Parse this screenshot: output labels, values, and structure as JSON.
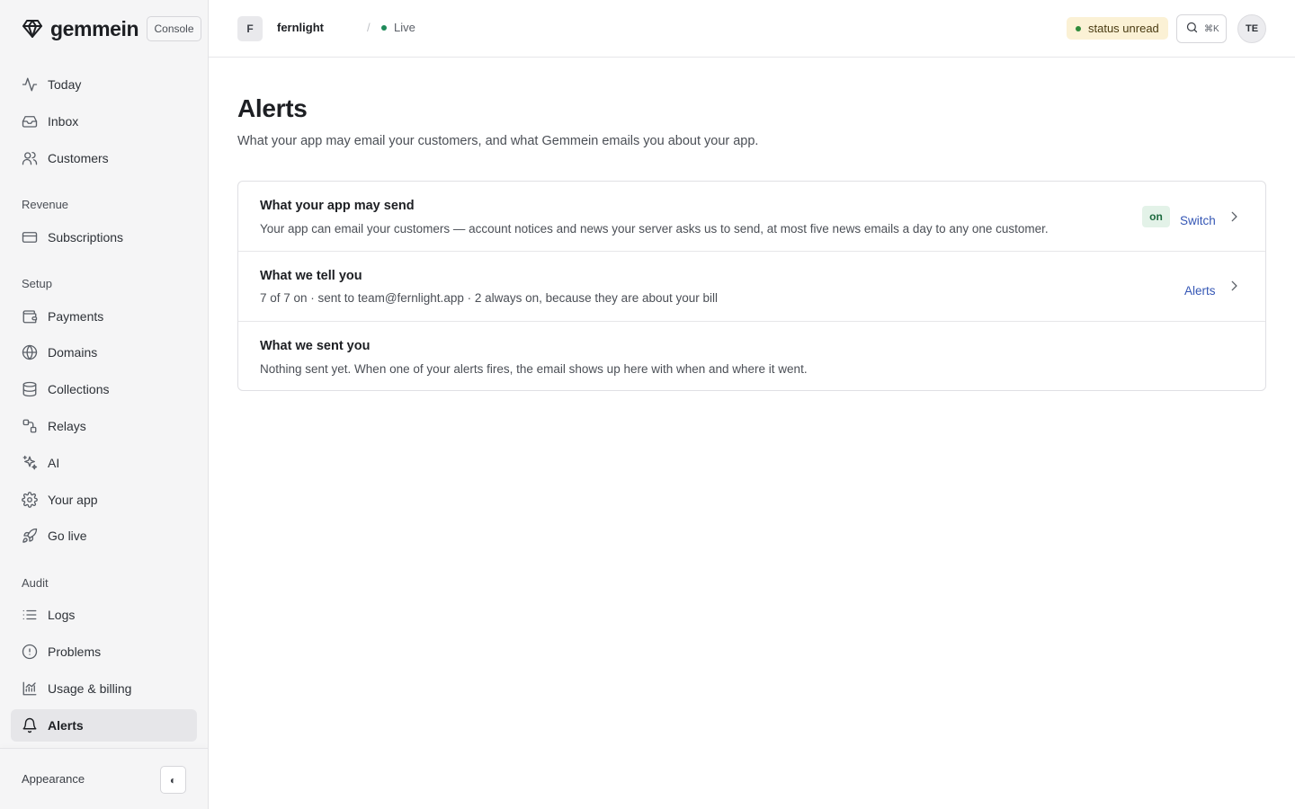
{
  "brand": {
    "name": "gemmein",
    "console_label": "Console",
    "logo_icon": "diamond-icon"
  },
  "sidebar": {
    "items_top": [
      {
        "label": "Today",
        "icon": "activity-icon"
      },
      {
        "label": "Inbox",
        "icon": "inbox-icon"
      },
      {
        "label": "Customers",
        "icon": "users-icon"
      }
    ],
    "sections": {
      "revenue": "Revenue",
      "setup": "Setup",
      "audit": "Audit"
    },
    "revenue_items": [
      {
        "label": "Subscriptions",
        "icon": "credit-card-icon"
      }
    ],
    "setup_items": [
      {
        "label": "Payments",
        "icon": "wallet-icon"
      },
      {
        "label": "Domains",
        "icon": "globe-icon"
      },
      {
        "label": "Collections",
        "icon": "database-icon"
      },
      {
        "label": "Relays",
        "icon": "route-icon"
      },
      {
        "label": "AI",
        "icon": "sparkles-icon"
      },
      {
        "label": "Your app",
        "icon": "gear-icon"
      },
      {
        "label": "Go live",
        "icon": "rocket-icon"
      }
    ],
    "audit_items": [
      {
        "label": "Logs",
        "icon": "list-icon"
      },
      {
        "label": "Problems",
        "icon": "alert-circle-icon"
      },
      {
        "label": "Usage & billing",
        "icon": "chart-icon"
      },
      {
        "label": "Alerts",
        "icon": "bell-icon",
        "active": true
      }
    ],
    "appearance_label": "Appearance",
    "appearance_toggle": "◐"
  },
  "topbar": {
    "project_initial": "F",
    "project_name": "fernlight",
    "separator": "/",
    "environment": "Live",
    "status": "status unread",
    "search_shortcut": "⌘K",
    "user_initials": "TE"
  },
  "page": {
    "title": "Alerts",
    "subtitle": "What your app may email your customers, and what Gemmein emails you about your app."
  },
  "rows": [
    {
      "title": "What your app may send",
      "desc": "Your app can email your customers — account notices and news your server asks us to send, at most five news emails a day to any one customer.",
      "badge": "on",
      "link": "Switch"
    },
    {
      "title": "What we tell you",
      "desc": "7 of 7 on · sent to team@fernlight.app · 2 always on, because they are about your bill",
      "link": "Alerts"
    },
    {
      "title": "What we sent you",
      "desc": "Nothing sent yet. When one of your alerts fires, the email shows up here with when and where it went."
    }
  ],
  "colors": {
    "accent_link": "#3557b5",
    "live_dot": "#1f8a5a",
    "status_bg": "#fbf1d5",
    "on_badge_bg": "#e3f2e8"
  }
}
